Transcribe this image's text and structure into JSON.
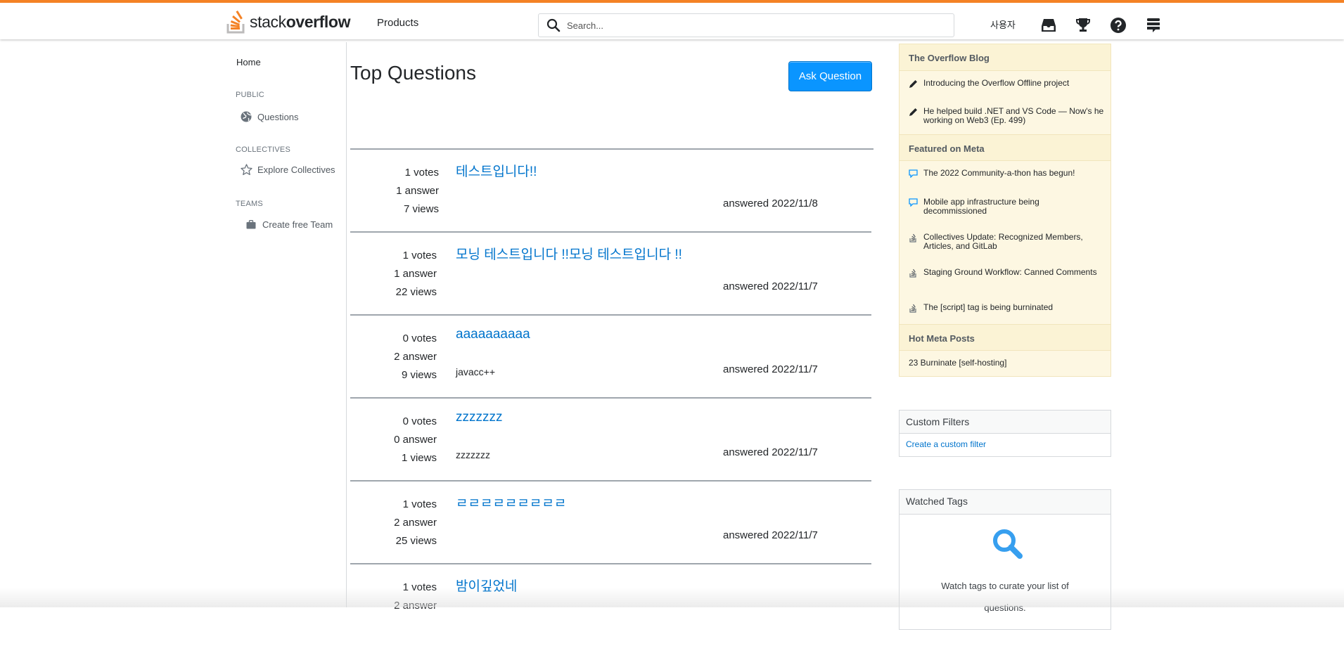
{
  "header": {
    "logo_text_light": "stack",
    "logo_text_bold": "overflow",
    "products_label": "Products",
    "search_placeholder": "Search...",
    "user_label": "사용자",
    "icons": [
      "inbox-icon",
      "trophy-icon",
      "help-icon",
      "stack-exchange-icon"
    ],
    "accent_color": "#f48225"
  },
  "sidebar_nav": {
    "home": "Home",
    "public_section": "PUBLIC",
    "questions": "Questions",
    "collectives_section": "COLLECTIVES",
    "explore_collectives": "Explore Collectives",
    "teams_section": "TEAMS",
    "create_team": "Create free Team"
  },
  "main": {
    "title": "Top Questions",
    "ask_button": "Ask Question",
    "questions": [
      {
        "votes": "1 votes",
        "answers": "1 answer",
        "views": "7 views",
        "title": "테스트입니다!!",
        "excerpt": "",
        "answered": "answered 2022/11/8"
      },
      {
        "votes": "1 votes",
        "answers": "1 answer",
        "views": "22 views",
        "title": "모닝 테스트입니다 !!모닝 테스트입니다 !!",
        "excerpt": "",
        "answered": "answered 2022/11/7"
      },
      {
        "votes": "0 votes",
        "answers": "2 answer",
        "views": "9 views",
        "title": "aaaaaaaaaa",
        "excerpt": "javacc++",
        "answered": "answered 2022/11/7"
      },
      {
        "votes": "0 votes",
        "answers": "0 answer",
        "views": "1 views",
        "title": "zzzzzzz",
        "excerpt": "zzzzzzz",
        "answered": "answered 2022/11/7"
      },
      {
        "votes": "1 votes",
        "answers": "2 answer",
        "views": "25 views",
        "title": "ㄹㄹㄹㄹㄹㄹㄹㄹㄹ",
        "excerpt": "",
        "answered": "answered 2022/11/7"
      },
      {
        "votes": "1 votes",
        "answers": "2 answer",
        "views": "",
        "title": "밤이깊었네",
        "excerpt": "",
        "answered": ""
      }
    ]
  },
  "right_sidebar": {
    "blog_header": "The Overflow Blog",
    "blog_items": [
      "Introducing the Overflow Offline project",
      "He helped build .NET and VS Code — Now's he working on Web3 (Ep. 499)"
    ],
    "meta_header": "Featured on Meta",
    "meta_items": [
      "The 2022 Community-a-thon has begun!",
      "Mobile app infrastructure being decommissioned",
      "Collectives Update: Recognized Members, Articles, and GitLab",
      "Staging Ground Workflow: Canned Comments",
      "The [script] tag is being burninated"
    ],
    "hot_header": "Hot Meta Posts",
    "hot_item": "23 Burninate [self-hosting]",
    "custom_filters_header": "Custom Filters",
    "custom_filters_link": "Create a custom filter",
    "watched_tags_header": "Watched Tags",
    "watched_tags_text": "Watch tags to curate your list of questions."
  }
}
